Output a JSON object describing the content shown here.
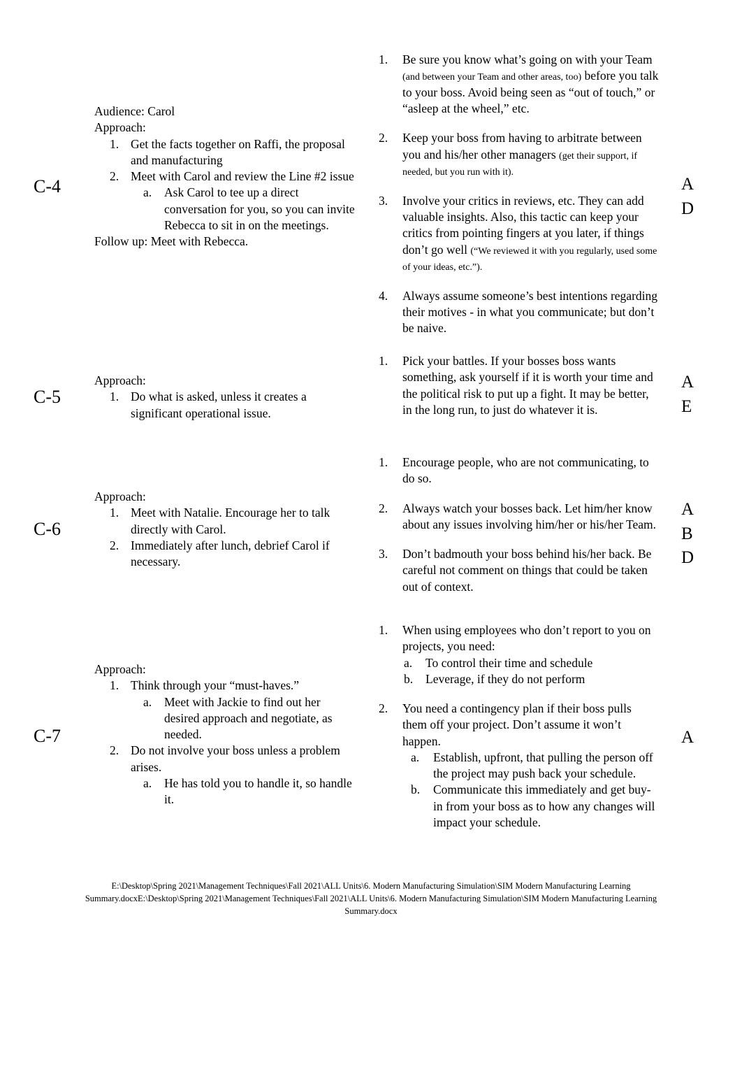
{
  "document": {
    "type": "learning-summary-worksheet",
    "footer_path": "E:\\Desktop\\Spring 2021\\Management Techniques\\Fall 2021\\ALL Units\\6. Modern Manufacturing Simulation\\SIM Modern Manufacturing Learning Summary.docxE:\\Desktop\\Spring 2021\\Management Techniques\\Fall 2021\\ALL Units\\6. Modern Manufacturing Simulation\\SIM Modern Manufacturing Learning Summary.docx"
  },
  "rows": {
    "c4": {
      "code": "C-4",
      "left": {
        "audience_line": "Audience: Carol",
        "approach_label": "Approach:",
        "items": [
          {
            "text": "Get the facts together on Raffi, the proposal and manufacturing"
          },
          {
            "text": "Meet with Carol and review the Line #2 issue",
            "sub": [
              "Ask Carol to tee up a direct conversation for you, so you can invite Rebecca to sit in on the meetings."
            ]
          }
        ],
        "follow_up_line": "Follow up:  Meet with Rebecca."
      },
      "right": {
        "items": [
          {
            "main": "Be sure you know what’s going on with your Team ",
            "note": "(and between your Team and other areas, too)",
            "tail": " before you talk to your boss.    Avoid being seen as “out of touch,” or “asleep at the wheel,” etc."
          },
          {
            "main": "Keep your boss from having to arbitrate between you and his/her other managers     ",
            "note": "(get their support, if needed, but you run with it).",
            "tail": ""
          },
          {
            "main": "Involve your critics in reviews, etc.  They can add valuable insights.  Also, this tactic can keep your critics from pointing fingers at you later, if things don’t go well ",
            "note": "(“We reviewed it with you regularly, used some of your ideas, etc.”).",
            "tail": ""
          },
          {
            "main": "Always assume someone’s best intentions regarding their motives  - in what you communicate; but don’t be naive.",
            "note": "",
            "tail": ""
          }
        ]
      },
      "letters": "A\nD"
    },
    "c5": {
      "code": "C-5",
      "left": {
        "approach_label": "Approach:",
        "items": [
          {
            "text": "Do what is asked, unless it creates a significant operational issue."
          }
        ]
      },
      "right": {
        "items": [
          {
            "main": "Pick your battles.   If your bosses boss wants something, ask yourself if it is worth your time and the political risk to put up a fight.  It may be better, in the long run, to just do whatever it is.",
            "note": "",
            "tail": ""
          }
        ]
      },
      "letters": "A\nE"
    },
    "c6": {
      "code": "C-6",
      "left": {
        "approach_label": "Approach:",
        "items": [
          {
            "text": "Meet with Natalie. Encourage her to talk directly with Carol."
          },
          {
            "text": "Immediately after lunch, debrief Carol if necessary."
          }
        ]
      },
      "right": {
        "items": [
          {
            "main": "Encourage people, who are not communicating, to do so.",
            "note": "",
            "tail": ""
          },
          {
            "main": "Always watch your bosses back.   Let him/her know about any issues involving him/her or his/her Team.",
            "note": "",
            "tail": ""
          },
          {
            "main": "Don’t badmouth your boss behind his/her back.  Be careful not comment on things that could be taken out of context.",
            "note": "",
            "tail": ""
          }
        ]
      },
      "letters": "A\nB\nD"
    },
    "c7": {
      "code": "C-7",
      "left": {
        "approach_label": "Approach:",
        "items": [
          {
            "text": "Think through your “must-haves.”",
            "sub": [
              "Meet with Jackie to find out her desired approach and negotiate, as needed."
            ]
          },
          {
            "text": "Do not involve your boss unless a problem arises.",
            "sub": [
              "He has told you to handle it, so handle it."
            ]
          }
        ]
      },
      "right": {
        "item1_main": "When using employees who don’t report to you on projects, you need:",
        "item1_sub": [
          "To control their time and schedule",
          "Leverage, if they do not perform"
        ],
        "item2_main": "You need a contingency plan if their boss pulls them off your project.   Don’t assume it won’t happen.",
        "item2_sub": [
          "Establish, upfront, that pulling the person off the project may push back your schedule.",
          "Communicate this immediately and get buy-in from your boss as to how any changes will impact your schedule."
        ]
      },
      "letters": "A"
    }
  }
}
